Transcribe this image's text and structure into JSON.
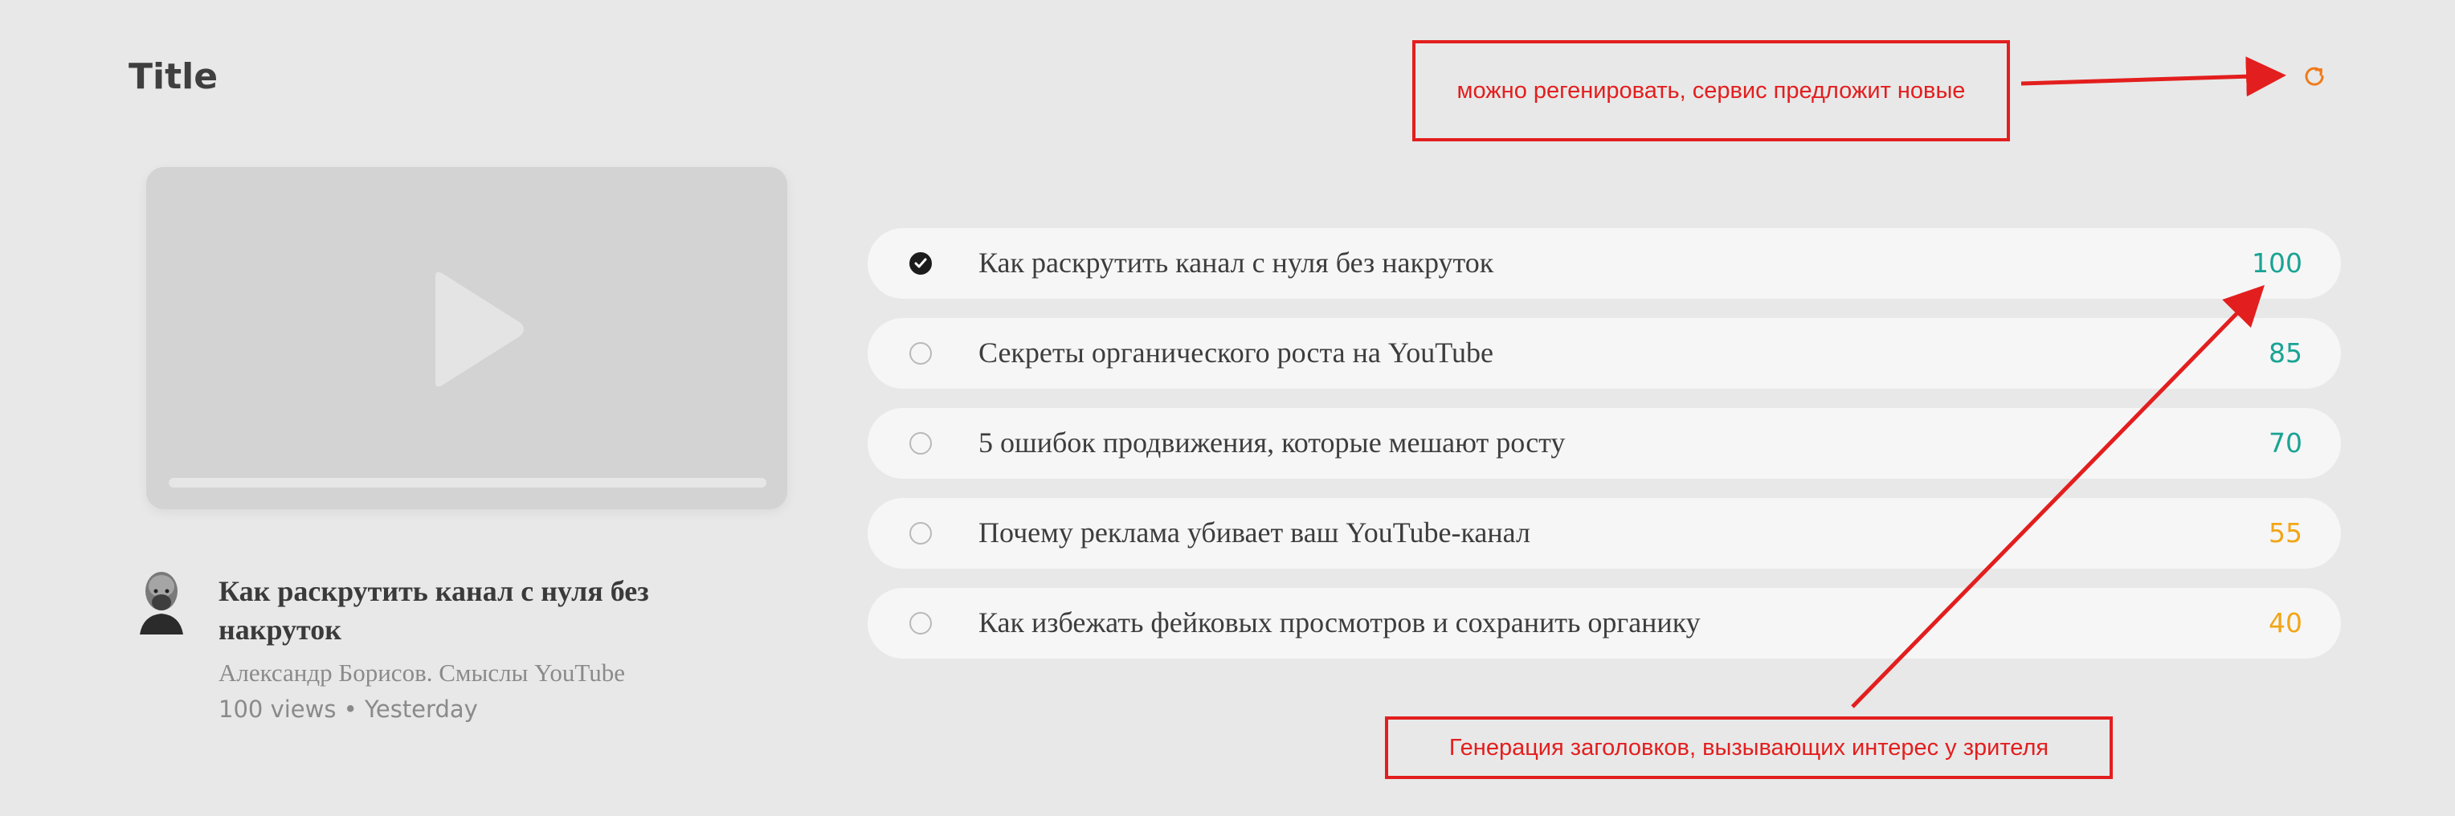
{
  "page": {
    "title": "Title"
  },
  "video": {
    "title": "Как раскрутить канал с нуля без накруток",
    "channel": "Александр Борисов. Смыслы YouTube",
    "views_line": "100 views • Yesterday"
  },
  "titles": [
    {
      "text": "Как раскрутить канал с нуля без накруток",
      "score": "100",
      "selected": true,
      "color": "#1aa394"
    },
    {
      "text": "Секреты органического роста на YouTube",
      "score": "85",
      "selected": false,
      "color": "#1aa394"
    },
    {
      "text": "5 ошибок продвижения, которые мешают росту",
      "score": "70",
      "selected": false,
      "color": "#1aa394"
    },
    {
      "text": "Почему реклама убивает ваш YouTube-канал",
      "score": "55",
      "selected": false,
      "color": "#f2a516"
    },
    {
      "text": "Как избежать фейковых просмотров и сохранить органику",
      "score": "40",
      "selected": false,
      "color": "#f2a516"
    }
  ],
  "annotations": {
    "regenerate": "можно регенировать, сервис предложит новые",
    "generation": "Генерация заголовков, вызывающих интерес у зрителя"
  },
  "icons": {
    "refresh": "refresh-icon",
    "play": "play-icon",
    "check": "check-icon"
  },
  "colors": {
    "accent_refresh": "#f07a1a",
    "annotation": "#e31e1e",
    "score_high": "#1aa394",
    "score_mid": "#f2a516"
  }
}
